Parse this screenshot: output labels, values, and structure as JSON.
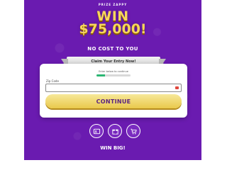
{
  "brand": {
    "name": "PRIZE ZAPPY"
  },
  "headline": {
    "line1": "WIN",
    "line2": "$75,000!"
  },
  "subhead": "NO COST TO YOU",
  "ribbon": {
    "text": "Claim Your Entry Now!"
  },
  "form": {
    "progress_label": "Enter below to continue",
    "progress_value": 0.25,
    "zip": {
      "label": "Zip Code",
      "value": "",
      "placeholder": ""
    },
    "button_label": "CONTINUE"
  },
  "feature_icons": [
    {
      "icon": "id-card-icon"
    },
    {
      "icon": "gift-box-icon"
    },
    {
      "icon": "shopping-cart-icon"
    }
  ],
  "footer_text": "WIN BIG!",
  "colors": {
    "background": "#6a1bb0",
    "accent_gold": "#f6d65c",
    "button": "#e9c94b",
    "progress": "#2bb673",
    "button_text": "#5a2380"
  }
}
